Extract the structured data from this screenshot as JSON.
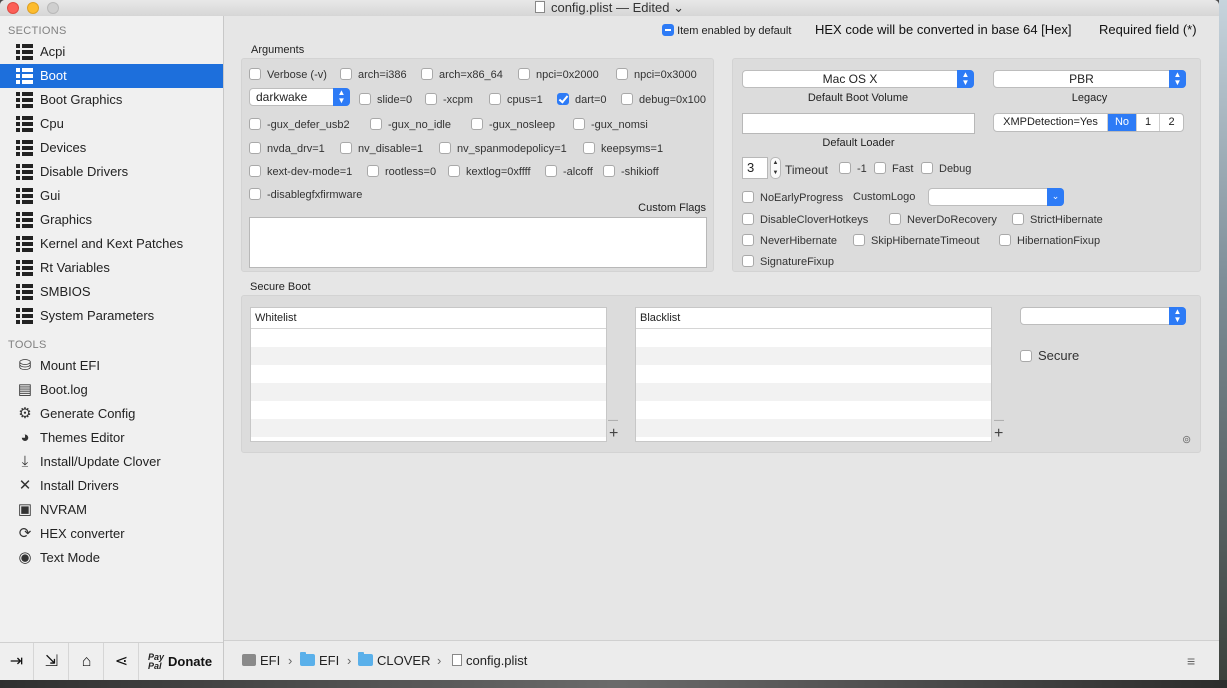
{
  "window": {
    "title": "config.plist",
    "status": "— Edited",
    "chevron": "⌄"
  },
  "sidebar": {
    "sections_title": "SECTIONS",
    "sections": [
      {
        "label": "Acpi"
      },
      {
        "label": "Boot"
      },
      {
        "label": "Boot Graphics"
      },
      {
        "label": "Cpu"
      },
      {
        "label": "Devices"
      },
      {
        "label": "Disable Drivers"
      },
      {
        "label": "Gui"
      },
      {
        "label": "Graphics"
      },
      {
        "label": "Kernel and Kext Patches"
      },
      {
        "label": "Rt Variables"
      },
      {
        "label": "SMBIOS"
      },
      {
        "label": "System Parameters"
      }
    ],
    "active_section": "Boot",
    "tools_title": "TOOLS",
    "tools": [
      {
        "label": "Mount EFI",
        "icon": "disk-utility-icon"
      },
      {
        "label": "Boot.log",
        "icon": "log-file-icon"
      },
      {
        "label": "Generate Config",
        "icon": "gear-icon"
      },
      {
        "label": "Themes Editor",
        "icon": "palette-icon"
      },
      {
        "label": "Install/Update Clover",
        "icon": "download-icon"
      },
      {
        "label": "Install Drivers",
        "icon": "tools-icon"
      },
      {
        "label": "NVRAM",
        "icon": "chip-icon"
      },
      {
        "label": "HEX converter",
        "icon": "convert-icon"
      },
      {
        "label": "Text Mode",
        "icon": "eye-icon"
      }
    ],
    "bottom": {
      "paypal_line1": "Pay",
      "paypal_line2": "Pal",
      "donate_label": "Donate"
    }
  },
  "legend": {
    "item_enabled": "Item enabled by default",
    "hex_note": "HEX code will be converted in base 64 [Hex]",
    "required": "Required field (*)"
  },
  "arguments": {
    "title": "Arguments",
    "row1": [
      {
        "label": "Verbose (-v)",
        "checked": false
      },
      {
        "label": "arch=i386",
        "checked": false
      },
      {
        "label": "arch=x86_64",
        "checked": false
      },
      {
        "label": "npci=0x2000",
        "checked": false
      },
      {
        "label": "npci=0x3000",
        "checked": false
      }
    ],
    "darkwake_value": "darkwake",
    "row2": [
      {
        "label": "slide=0",
        "checked": false
      },
      {
        "label": "-xcpm",
        "checked": false
      },
      {
        "label": "cpus=1",
        "checked": false
      },
      {
        "label": "dart=0",
        "checked": true
      },
      {
        "label": "debug=0x100",
        "checked": false
      }
    ],
    "row3": [
      {
        "label": "-gux_defer_usb2",
        "checked": false
      },
      {
        "label": "-gux_no_idle",
        "checked": false
      },
      {
        "label": "-gux_nosleep",
        "checked": false
      },
      {
        "label": "-gux_nomsi",
        "checked": false
      }
    ],
    "row4": [
      {
        "label": "nvda_drv=1",
        "checked": false
      },
      {
        "label": "nv_disable=1",
        "checked": false
      },
      {
        "label": "nv_spanmodepolicy=1",
        "checked": false
      },
      {
        "label": "keepsyms=1",
        "checked": false
      }
    ],
    "row5": [
      {
        "label": "kext-dev-mode=1",
        "checked": false
      },
      {
        "label": "rootless=0",
        "checked": false
      },
      {
        "label": "kextlog=0xffff",
        "checked": false
      },
      {
        "label": "-alcoff",
        "checked": false
      },
      {
        "label": "-shikioff",
        "checked": false
      }
    ],
    "row6": [
      {
        "label": "-disablegfxfirmware",
        "checked": false
      }
    ],
    "custom_flags_label": "Custom Flags",
    "custom_flags_value": ""
  },
  "boot": {
    "default_volume_value": "Mac OS X",
    "default_volume_label": "Default Boot Volume",
    "legacy_value": "PBR",
    "legacy_label": "Legacy",
    "default_loader_value": "",
    "default_loader_label": "Default Loader",
    "xmp_label": "XMPDetection=Yes",
    "xmp_options": [
      "No",
      "1",
      "2"
    ],
    "xmp_selected": "No",
    "timeout_value": "3",
    "timeout_label": "Timeout",
    "timeout_options": [
      {
        "label": "-1",
        "checked": false
      },
      {
        "label": "Fast",
        "checked": false
      },
      {
        "label": "Debug",
        "checked": false
      }
    ],
    "no_early_progress": "NoEarlyProgress",
    "custom_logo_label": "CustomLogo",
    "custom_logo_value": "",
    "flags_row1": [
      {
        "label": "DisableCloverHotkeys",
        "checked": false
      },
      {
        "label": "NeverDoRecovery",
        "checked": false
      },
      {
        "label": "StrictHibernate",
        "checked": false
      }
    ],
    "flags_row2": [
      {
        "label": "NeverHibernate",
        "checked": false
      },
      {
        "label": "SkipHibernateTimeout",
        "checked": false
      },
      {
        "label": "HibernationFixup",
        "checked": false
      }
    ],
    "flags_row3": [
      {
        "label": "SignatureFixup",
        "checked": false
      }
    ]
  },
  "secure_boot": {
    "title": "Secure Boot",
    "whitelist_header": "Whitelist",
    "blacklist_header": "Blacklist",
    "policy_value": "",
    "secure_label": "Secure",
    "secure_checked": false,
    "add_symbol": "+",
    "remove_symbol": "—"
  },
  "pathbar": {
    "items": [
      "EFI",
      "EFI",
      "CLOVER",
      "config.plist"
    ],
    "separator": "›"
  },
  "colors": {
    "accent": "#2d7bf6",
    "selection": "#1d6fdc"
  }
}
